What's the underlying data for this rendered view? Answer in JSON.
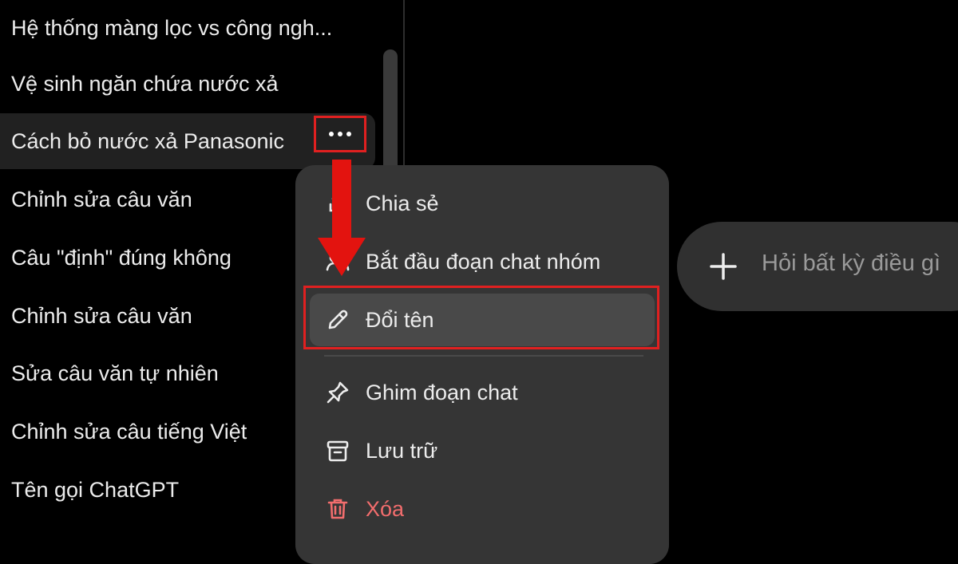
{
  "sidebar": {
    "chats": [
      "Hệ thống màng lọc vs công ngh...",
      "Vệ sinh ngăn chứa nước xả",
      "Cách bỏ nước xả Panasonic",
      "Chỉnh sửa câu văn",
      "Câu \"định\" đúng không",
      "Chỉnh sửa câu văn",
      "Sửa câu văn tự nhiên",
      "Chỉnh sửa câu tiếng Việt",
      "Tên gọi ChatGPT"
    ]
  },
  "menu": {
    "items": [
      {
        "label": "Chia sẻ",
        "icon": "share-icon"
      },
      {
        "label": "Bắt đầu đoạn chat nhóm",
        "icon": "group-chat-icon"
      },
      {
        "label": "Đổi tên",
        "icon": "pencil-icon"
      },
      {
        "label": "Ghim đoạn chat",
        "icon": "pin-icon"
      },
      {
        "label": "Lưu trữ",
        "icon": "archive-icon"
      },
      {
        "label": "Xóa",
        "icon": "trash-icon"
      }
    ]
  },
  "composer": {
    "placeholder": "Hỏi bất kỳ điều gì"
  },
  "colors": {
    "annotation": "#e02020",
    "danger": "#f26d6d",
    "menu_bg": "#353535"
  }
}
